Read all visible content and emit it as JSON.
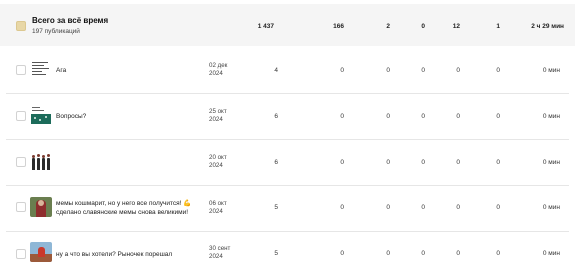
{
  "summary": {
    "title": "Всего за всё время",
    "subtitle": "197 публикаций",
    "values": [
      "1 437",
      "166",
      "2",
      "0",
      "12",
      "1",
      "2 ч 29 мин"
    ]
  },
  "rows": [
    {
      "title": "Ага",
      "date": "02 дек\n2024",
      "values": [
        "4",
        "0",
        "0",
        "0",
        "0",
        "0",
        "0 мин"
      ],
      "thumb": "notes-thumbnail"
    },
    {
      "title": "Вопросы?",
      "date": "25 окт\n2024",
      "values": [
        "6",
        "0",
        "0",
        "0",
        "0",
        "0",
        "0 мин"
      ],
      "thumb": "green-slide-thumbnail"
    },
    {
      "title": "",
      "date": "20 окт\n2024",
      "values": [
        "6",
        "0",
        "0",
        "0",
        "0",
        "0",
        "0 мин"
      ],
      "thumb": "group-figures-thumbnail"
    },
    {
      "title": "мемы кошмарит, но у него все получится! 💪 сделано славянские мемы снова великими!",
      "date": "06 окт\n2024",
      "values": [
        "5",
        "0",
        "0",
        "0",
        "0",
        "0",
        "0 мин"
      ],
      "thumb": "person-photo-thumbnail"
    },
    {
      "title": "ну а что вы хотели? Рыночек порешал",
      "date": "30 сент\n2024",
      "values": [
        "5",
        "0",
        "0",
        "0",
        "0",
        "0",
        "0 мин"
      ],
      "thumb": "street-photo-thumbnail"
    }
  ],
  "colors": {
    "summary_bg": "#f5f5f5",
    "checkbox_accent": "#e8d7a6",
    "separator": "#e6e6e6"
  }
}
